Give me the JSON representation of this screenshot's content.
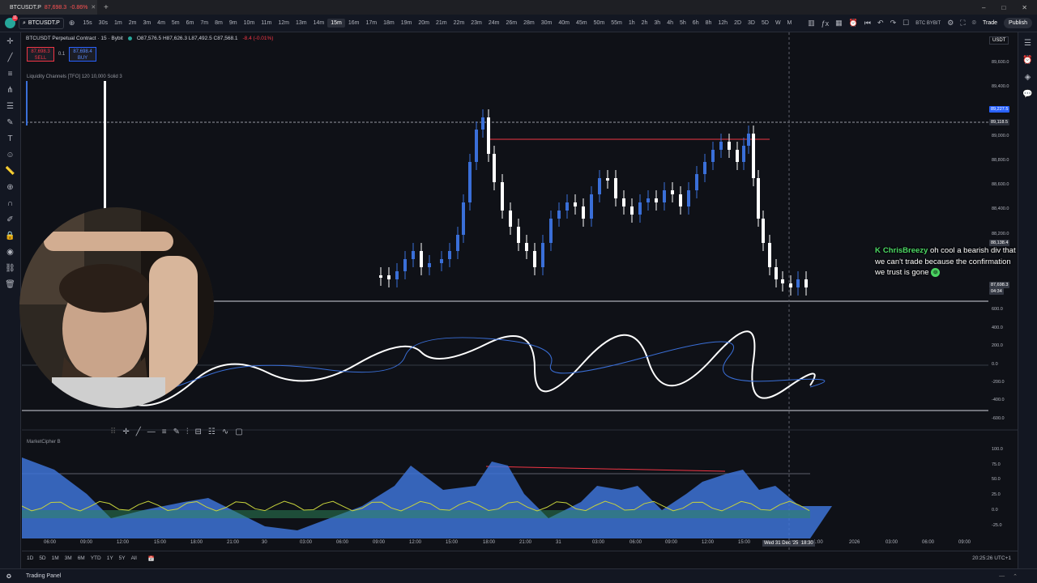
{
  "browser": {
    "tab_title": "BTCUSDT.P",
    "tab_price": "87,698.3",
    "tab_change": "-0.86%",
    "new_tab": "+",
    "window_controls": [
      "–",
      "□",
      "✕"
    ]
  },
  "toolbar": {
    "avatar_badge": "11",
    "symbol": "BTCUSDT.P",
    "intervals": [
      "15s",
      "30s",
      "1m",
      "2m",
      "3m",
      "4m",
      "5m",
      "6m",
      "7m",
      "8m",
      "9m",
      "10m",
      "11m",
      "12m",
      "13m",
      "14m",
      "15m",
      "16m",
      "17m",
      "18m",
      "19m",
      "20m",
      "21m",
      "22m",
      "23m",
      "24m",
      "26m",
      "28m",
      "30m",
      "40m",
      "45m",
      "50m",
      "55m",
      "1h",
      "2h",
      "3h",
      "4h",
      "5h",
      "6h",
      "8h",
      "12h",
      "2D",
      "3D",
      "5D",
      "W",
      "M"
    ],
    "active_interval": "15m",
    "exchange": "BTC BYBIT",
    "trade_label": "Trade",
    "publish_label": "Publish"
  },
  "legend": {
    "title": "BTCUSDT Perpetual Contract · 15 · Bybit",
    "ohlc": "O87,576.5 H87,626.3 L87,492.5 C87,568.1",
    "change": "-8.4 (-0.01%)",
    "sell_price": "87,698.3",
    "sell_label": "SELL",
    "spread": "0.1",
    "buy_price": "87,698.4",
    "buy_label": "BUY",
    "indicator": "Liquidity Channels [TFO] 120 10,000 Solid 3",
    "marketcipher": "MarketCipher B"
  },
  "price_axis": {
    "currency": "USDT",
    "labels": [
      "89,600.0",
      "89,400.0",
      "89,000.0",
      "88,800.0",
      "88,600.0",
      "88,400.0",
      "88,200.0"
    ],
    "tag_blue": "89,227.5",
    "tag_hline": "89,118.5",
    "tag_mid": "88,138.4",
    "tag_last": "87,698.3",
    "tag_countdown": "04:34"
  },
  "macd_axis": [
    "600.0",
    "400.0",
    "200.0",
    "0.0",
    "-200.0",
    "-400.0",
    "-600.0"
  ],
  "mcb_axis": [
    "100.0",
    "75.0",
    "50.0",
    "25.0",
    "0.0",
    "-25.0"
  ],
  "time_axis": [
    "06:00",
    "09:00",
    "12:00",
    "15:00",
    "18:00",
    "21:00",
    "30",
    "03:00",
    "06:00",
    "09:00",
    "12:00",
    "15:00",
    "18:00",
    "21:00",
    "31",
    "03:00",
    "06:00",
    "09:00",
    "12:00",
    "15:00",
    "18:00",
    "1:00",
    "2026",
    "03:00",
    "06:00",
    "09:00"
  ],
  "crosshair_time": "Wed 31 Dec '25",
  "crosshair_time2": "18:30",
  "bottom_ranges": [
    "1D",
    "5D",
    "1M",
    "3M",
    "6M",
    "YTD",
    "1Y",
    "5Y",
    "All"
  ],
  "clock": "20:25:26 UTC+1",
  "panel_title": "Trading Panel",
  "chat": {
    "user": "ChrisBreezy",
    "message": "oh cool a bearish div that we can't trade because the confirmation we trust is gone"
  }
}
